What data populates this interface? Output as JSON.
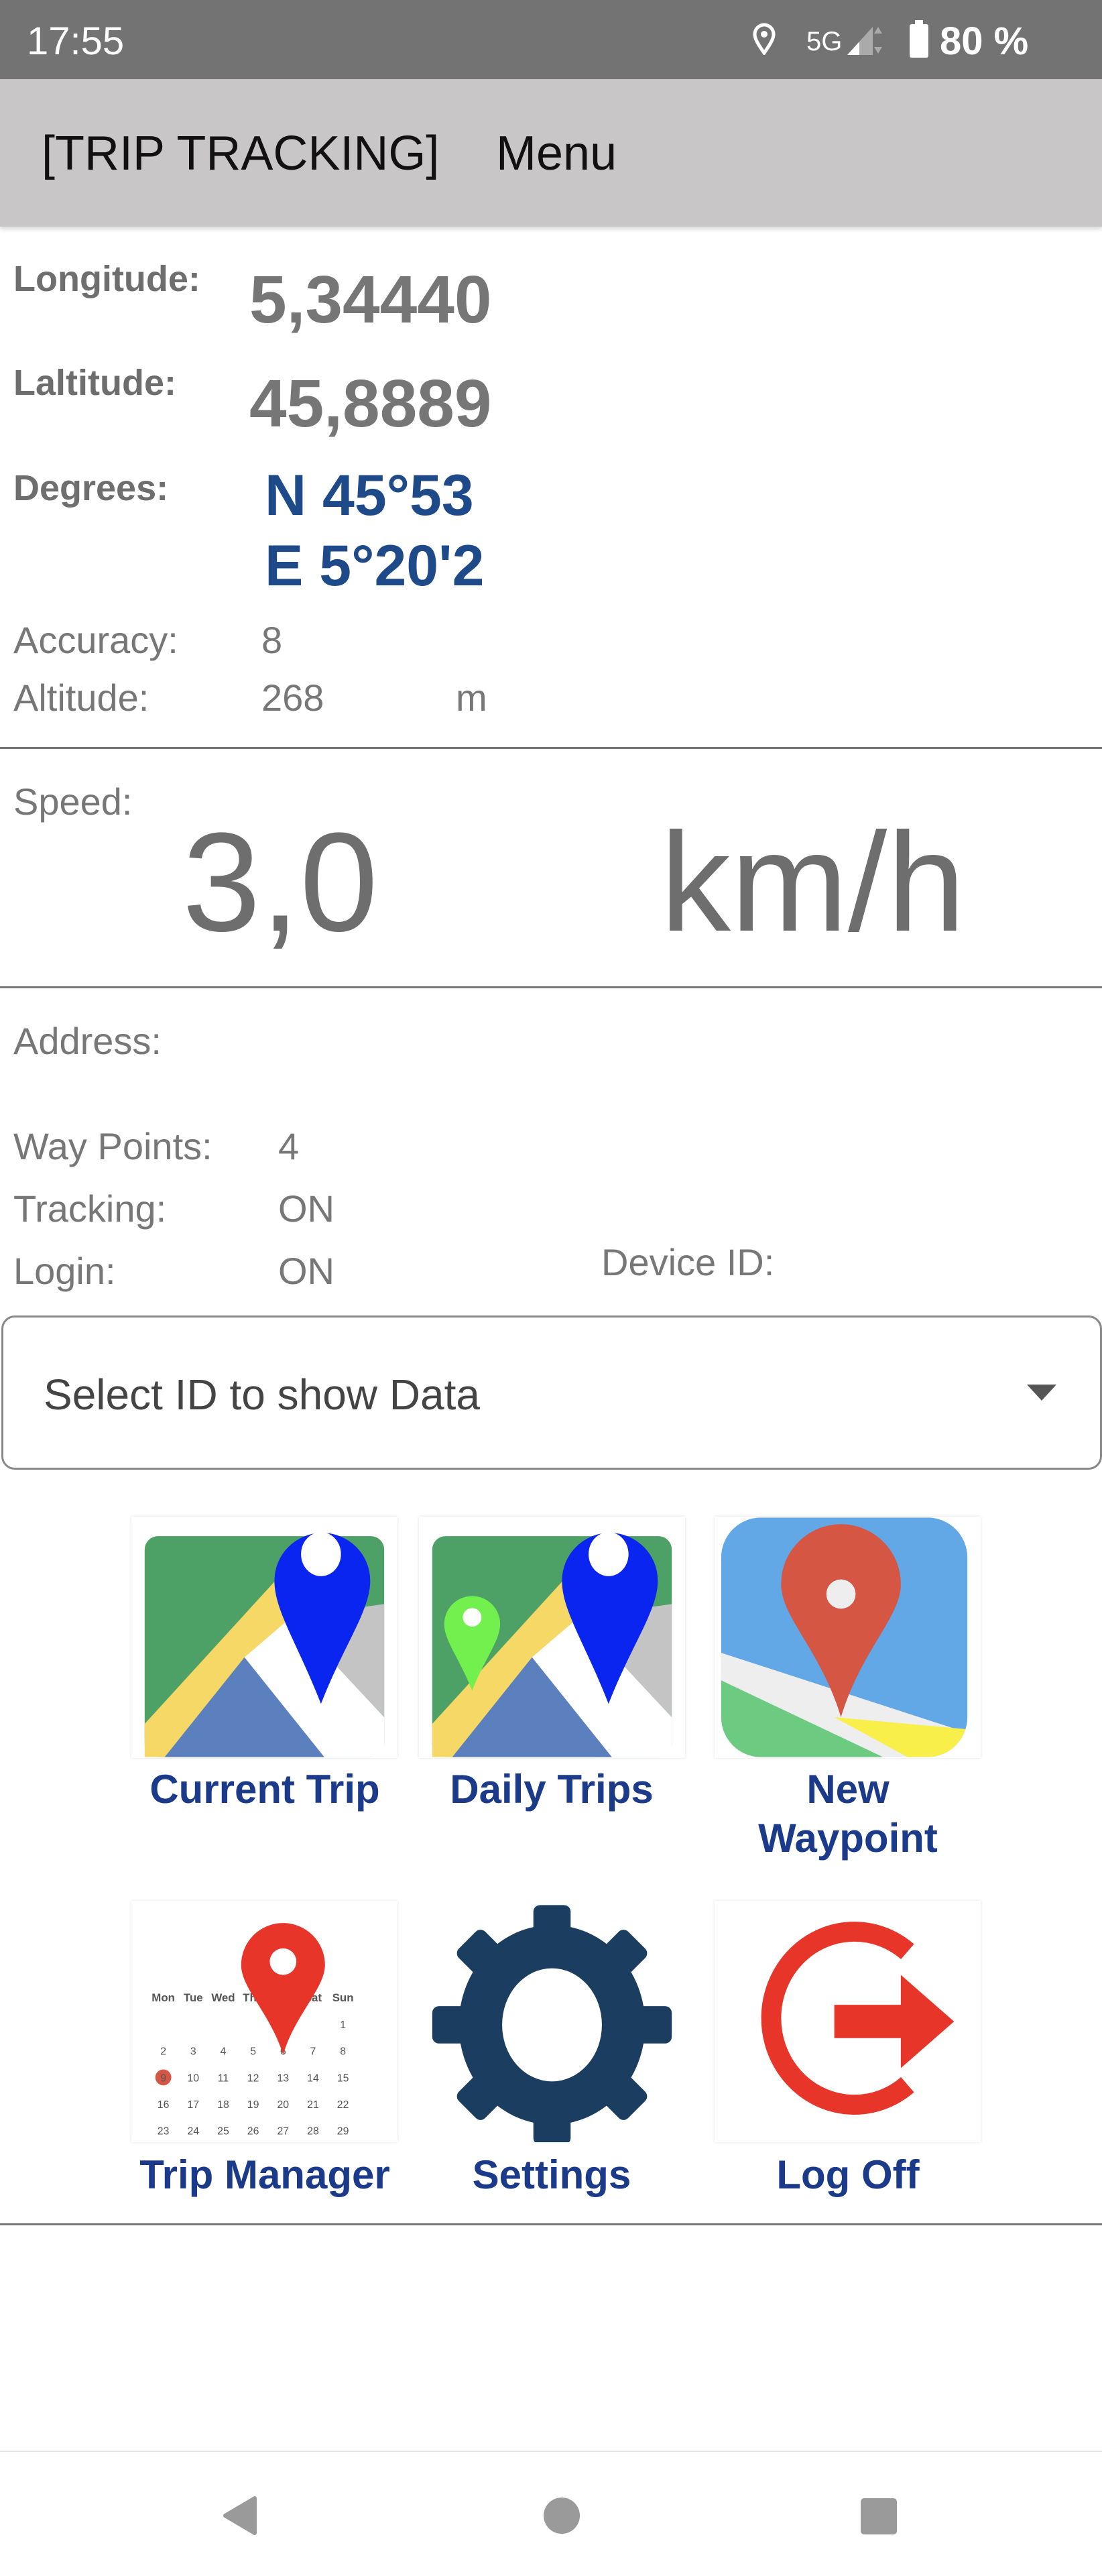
{
  "status_bar": {
    "time": "17:55",
    "network": "5G",
    "battery": "80 %",
    "icons": [
      "location-icon",
      "signal-icon",
      "battery-icon"
    ]
  },
  "app_bar": {
    "title": "[TRIP TRACKING]",
    "menu_label": "Menu"
  },
  "position": {
    "longitude_label": "Longitude:",
    "longitude_value": "5,34440",
    "latitude_label": "Laltitude:",
    "latitude_value": "45,8889",
    "degrees_label": "Degrees:",
    "degrees_north": "N 45°53",
    "degrees_east": "E 5°20'2",
    "accuracy_label": "Accuracy:",
    "accuracy_value": "8",
    "altitude_label": "Altitude:",
    "altitude_value": "268",
    "altitude_unit": "m"
  },
  "speed": {
    "label": "Speed:",
    "value": "3,0",
    "unit": "km/h"
  },
  "info": {
    "address_label": "Address:",
    "waypoints_label": "Way Points:",
    "waypoints_value": "4",
    "tracking_label": "Tracking:",
    "tracking_value": "ON",
    "login_label": "Login:",
    "login_value": "ON",
    "device_id_label": "Device ID:"
  },
  "device_select": {
    "placeholder": "Select ID to show Data"
  },
  "tiles": [
    {
      "label": "Current Trip",
      "icon": "map-pin-icon"
    },
    {
      "label": "Daily Trips",
      "icon": "map-multi-pin-icon"
    },
    {
      "label_line1": "New",
      "label_line2": "Waypoint",
      "icon": "waypoint-icon"
    },
    {
      "label": "Trip Manager",
      "icon": "calendar-pin-icon"
    },
    {
      "label": "Settings",
      "icon": "gear-icon"
    },
    {
      "label": "Log Off",
      "icon": "logout-icon"
    }
  ],
  "calendar": {
    "days": [
      "Mon",
      "Tue",
      "Wed",
      "Thu",
      "Sat",
      "Sun"
    ]
  },
  "colors": {
    "label_blue": "#1b3a8a",
    "degrees_blue": "#1e4a8a",
    "pin_blue": "#0a25f0",
    "pin_red": "#e8352a",
    "gear": "#1b3d5f"
  }
}
